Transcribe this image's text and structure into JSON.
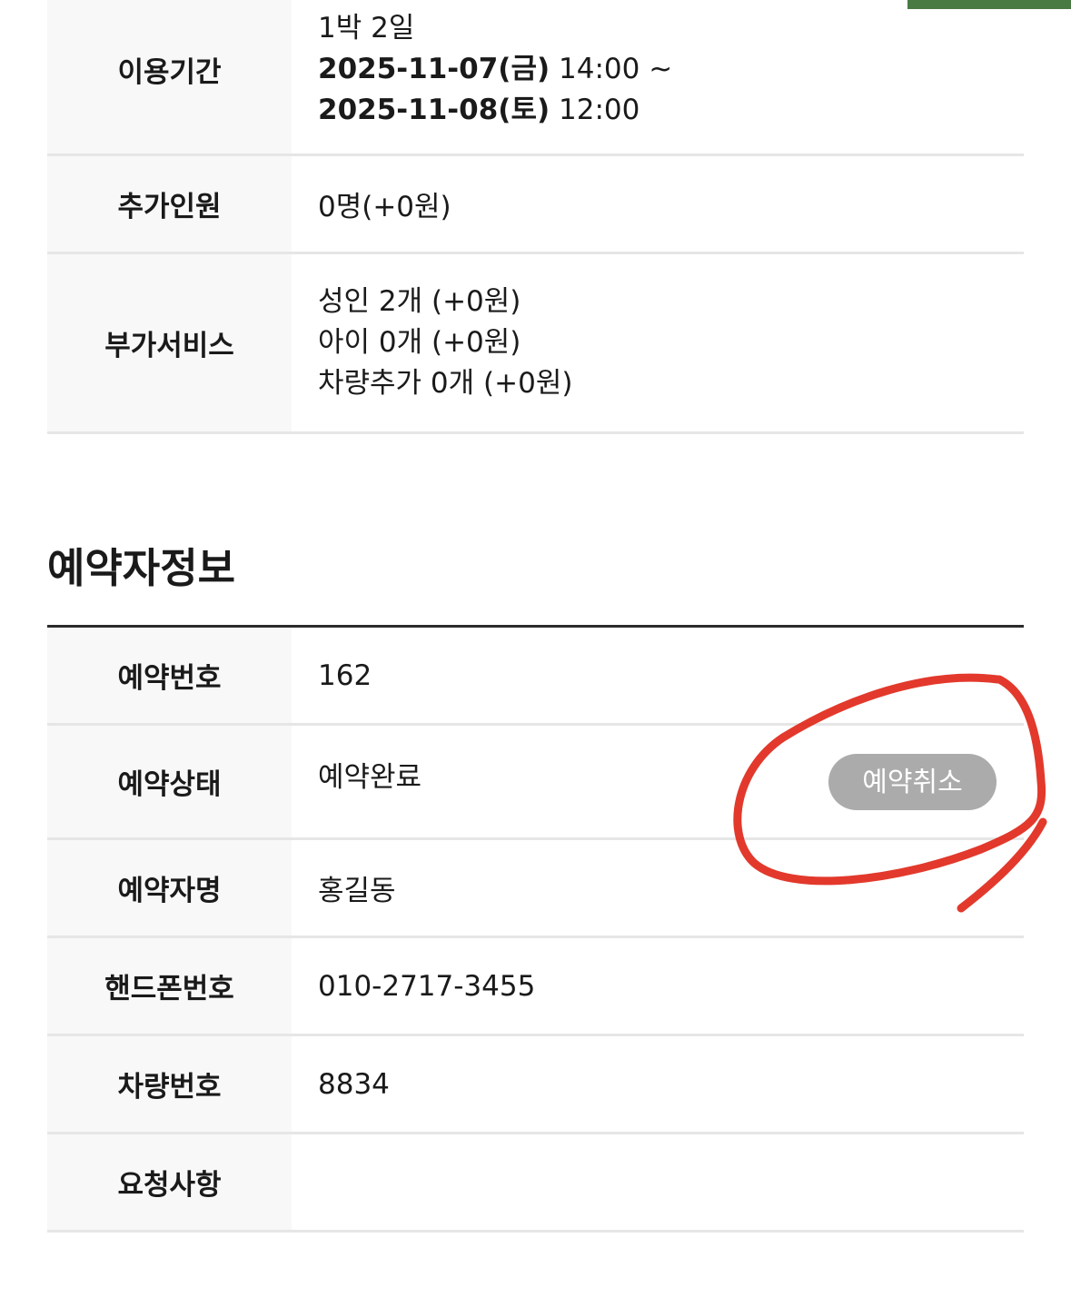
{
  "usage": {
    "period_label": "이용기간",
    "nights": "1박 2일",
    "checkin_date": "2025-11-07(금)",
    "checkin_time": " 14:00 ~",
    "checkout_date": "2025-11-08(토)",
    "checkout_time": " 12:00",
    "extra_people_label": "추가인원",
    "extra_people_value": "0명(+0원)",
    "services_label": "부가서비스",
    "services": [
      "성인 2개 (+0원)",
      "아이 0개 (+0원)",
      "차량추가 0개 (+0원)"
    ]
  },
  "booker": {
    "section_title": "예약자정보",
    "rows": [
      {
        "label": "예약번호",
        "value": "162"
      },
      {
        "label": "예약상태",
        "value": "예약완료"
      },
      {
        "label": "예약자명",
        "value": "홍길동"
      },
      {
        "label": "핸드폰번호",
        "value": "010-2717-3455"
      },
      {
        "label": "차량번호",
        "value": "8834"
      },
      {
        "label": "요청사항",
        "value": ""
      }
    ],
    "cancel_button": "예약취소"
  },
  "colors": {
    "accent_bar": "#4a7a44",
    "cancel_button": "#ababab",
    "annotation": "#e0281a"
  }
}
